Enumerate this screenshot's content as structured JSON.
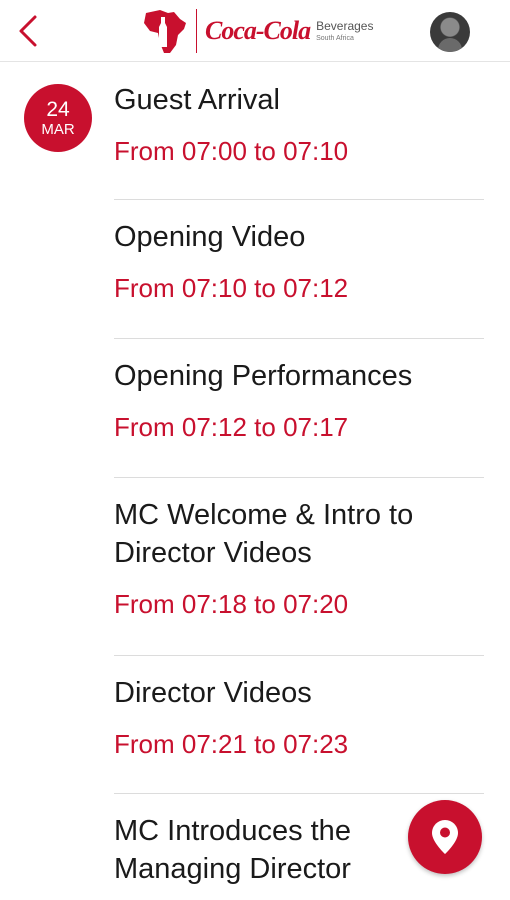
{
  "header": {
    "brand": "Coca-Cola",
    "brand_sub_line1": "Beverages",
    "brand_sub_line2": "South Africa",
    "logo_text": "Coca-Cola Beverages South Africa"
  },
  "date_badge": {
    "day": "24",
    "month": "MAR"
  },
  "schedule": [
    {
      "title": "Guest Arrival",
      "time": "From 07:00 to 07:10"
    },
    {
      "title": "Opening Video",
      "time": "From 07:10 to 07:12"
    },
    {
      "title": "Opening Performances",
      "time": "From 07:12 to 07:17"
    },
    {
      "title": "MC Welcome & Intro to Director Videos",
      "time": "From 07:18 to 07:20"
    },
    {
      "title": "Director Videos",
      "time": "From 07:21 to 07:23"
    },
    {
      "title": "MC Introduces the Managing Director",
      "time": ""
    }
  ],
  "colors": {
    "accent": "#c8102e"
  },
  "icons": {
    "back": "chevron-left-icon",
    "fab": "map-pin-icon",
    "logo": "africa-bottle-icon"
  }
}
